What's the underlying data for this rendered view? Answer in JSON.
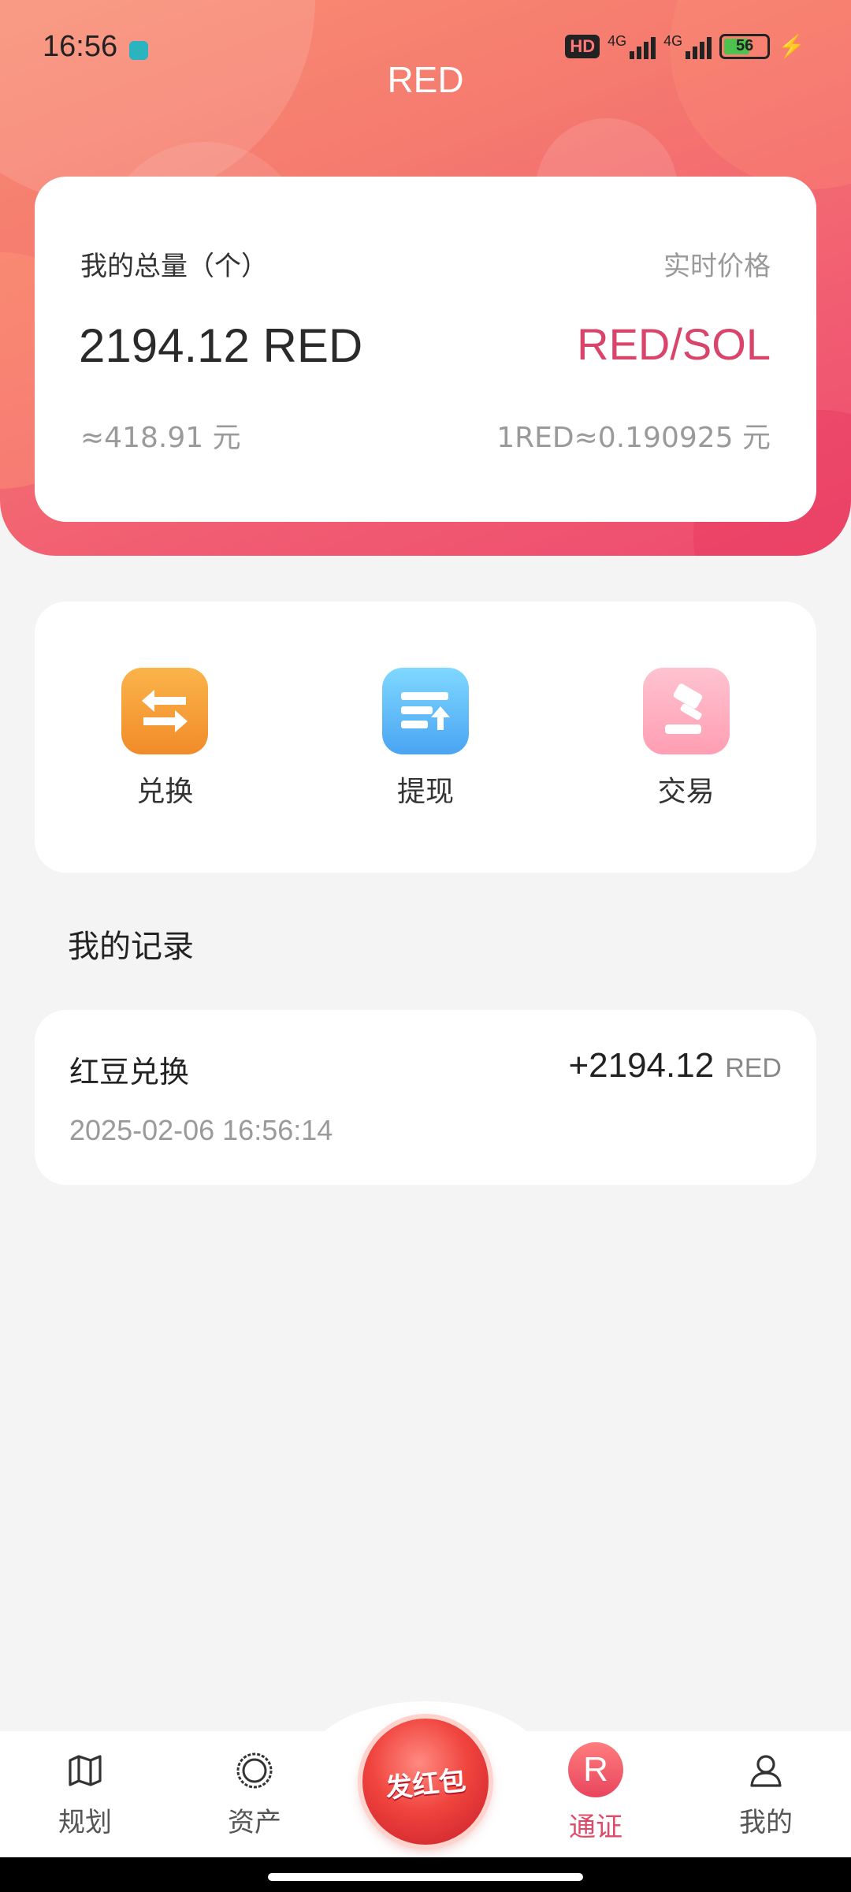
{
  "status_bar": {
    "time": "16:56",
    "network": "4G",
    "battery": "56",
    "hd": "HD"
  },
  "header": {
    "title": "RED"
  },
  "summary": {
    "total_label": "我的总量（个）",
    "price_label": "实时价格",
    "total_amount": "2194.12 RED",
    "pair": "RED/SOL",
    "cny_value": "≈418.91 元",
    "rate": "1RED≈0.190925 元"
  },
  "actions": [
    {
      "label": "兑换",
      "icon": "swap-icon",
      "color": "#f39c2e"
    },
    {
      "label": "提现",
      "icon": "withdraw-icon",
      "color": "#4aa4f2"
    },
    {
      "label": "交易",
      "icon": "auction-hammer-icon",
      "color": "#ff9eb3"
    }
  ],
  "records": {
    "title": "我的记录",
    "items": [
      {
        "name": "红豆兑换",
        "amount": "+2194.12",
        "unit": "RED",
        "datetime": "2025-02-06 16:56:14"
      }
    ]
  },
  "bottom_nav": {
    "items": [
      {
        "label": "规划",
        "icon": "map-icon"
      },
      {
        "label": "资产",
        "icon": "ring-icon"
      },
      {
        "label": "发红包",
        "icon": "red-packet-icon"
      },
      {
        "label": "通证",
        "icon": "r-badge-icon",
        "badge": "R",
        "active": true
      },
      {
        "label": "我的",
        "icon": "user-icon"
      }
    ]
  },
  "colors": {
    "accent": "#e04a68",
    "header_gradient_start": "#f98e73",
    "header_gradient_end": "#ee4a6e"
  }
}
